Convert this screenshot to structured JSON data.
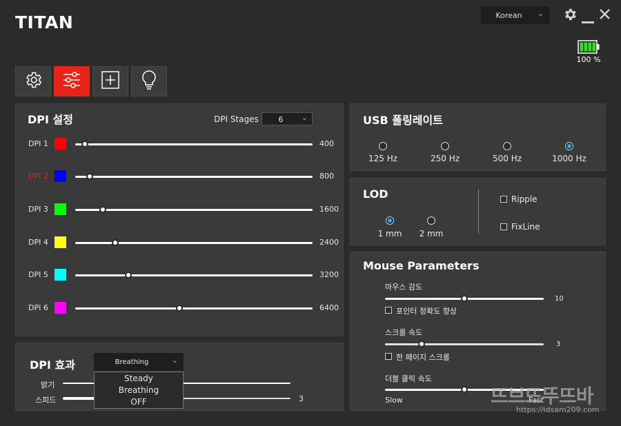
{
  "app": {
    "logo": "TITAN",
    "language": "Korean",
    "battery_text": "100 %",
    "battery_level": 1.0
  },
  "tabs": [
    {
      "icon": "gear-icon",
      "active": false
    },
    {
      "icon": "sliders-icon",
      "active": true
    },
    {
      "icon": "macro-plus-icon",
      "active": false
    },
    {
      "icon": "lightbulb-icon",
      "active": false
    }
  ],
  "dpi": {
    "title": "DPI 설정",
    "stages_label": "DPI Stages",
    "stages_value": "6",
    "rows": [
      {
        "name": "DPI 1",
        "color": "#ff0000",
        "value": "400",
        "level": 0.04,
        "highlight": false
      },
      {
        "name": "DPI 2",
        "color": "#0000ff",
        "value": "800",
        "level": 0.06,
        "highlight": true
      },
      {
        "name": "DPI 3",
        "color": "#00ff00",
        "value": "1600",
        "level": 0.117,
        "highlight": false
      },
      {
        "name": "DPI 4",
        "color": "#ffff00",
        "value": "2400",
        "level": 0.17,
        "highlight": false
      },
      {
        "name": "DPI 5",
        "color": "#00ffff",
        "value": "3200",
        "level": 0.225,
        "highlight": false
      },
      {
        "name": "DPI 6",
        "color": "#ff00ff",
        "value": "6400",
        "level": 0.44,
        "highlight": false
      }
    ],
    "highlight_color": "#e8241a"
  },
  "dpi_effect": {
    "title": "DPI 효과",
    "selected": "Breathing",
    "options": [
      "Steady",
      "Breathing",
      "OFF"
    ],
    "brightness_label": "밝기",
    "speed_label": "스피드",
    "speed_value": "3"
  },
  "usb": {
    "title": "USB 폴링레이트",
    "options": [
      "125 Hz",
      "250 Hz",
      "500 Hz",
      "1000 Hz"
    ],
    "selected_index": 3
  },
  "lod": {
    "title": "LOD",
    "options": [
      "1 mm",
      "2 mm"
    ],
    "selected_index": 0,
    "checkboxes": [
      "Ripple",
      "FixLine"
    ]
  },
  "mouse": {
    "title": "Mouse Parameters",
    "sensitivity_label": "마우스 감도",
    "sensitivity_value": "10",
    "sensitivity_level": 0.5,
    "pointer_precision_label": "포인터 정확도 향상",
    "scroll_label": "스크롤 속도",
    "scroll_value": "3",
    "scroll_level": 0.23,
    "page_scroll_label": "한 페이지 스크롤",
    "dblclick_label": "더블 클릭 속도",
    "dblclick_level": 0.5,
    "slow_label": "Slow",
    "fast_label": "Fast"
  },
  "watermark": {
    "logo": "뜨브뜨뚜뜨바",
    "url": "https://idsam209.com"
  }
}
